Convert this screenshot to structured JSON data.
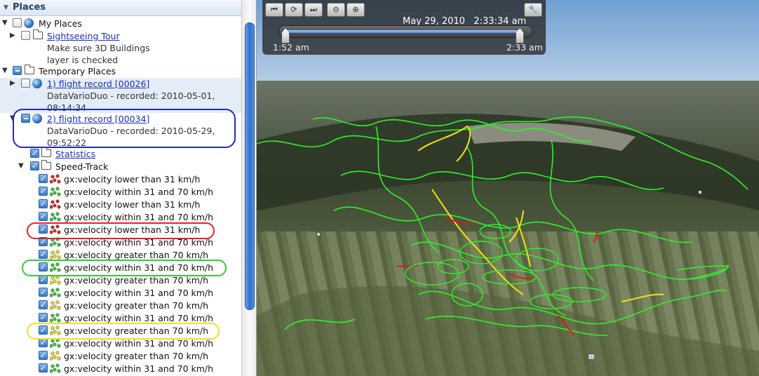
{
  "places": {
    "header": "Places",
    "my_places": {
      "label": "My Places",
      "sightseeing": {
        "label": "Sightseeing Tour",
        "note_line1": "Make sure 3D Buildings",
        "note_line2": "layer is checked"
      }
    },
    "temporary_places": {
      "label": "Temporary Places",
      "record1": {
        "label": "1) flight record [00026]",
        "desc_line1": "DataVarioDuo - recorded: 2010-05-01,",
        "desc_line2": "08:14:34"
      },
      "record2": {
        "label": "2) flight record [00034]",
        "desc_line1": "DataVarioDuo - recorded: 2010-05-29,",
        "desc_line2": "09:52:22"
      },
      "statistics": "Statistics",
      "speed_track": "Speed-Track",
      "segments": [
        {
          "label": "gx:velocity lower than 31 km/h",
          "color": "red"
        },
        {
          "label": "gx:velocity within  31 and 70 km/h",
          "color": "green"
        },
        {
          "label": "gx:velocity lower than 31 km/h",
          "color": "red"
        },
        {
          "label": "gx:velocity within  31 and 70 km/h",
          "color": "green"
        },
        {
          "label": "gx:velocity lower than 31 km/h",
          "color": "red"
        },
        {
          "label": "gx:velocity within  31 and 70 km/h",
          "color": "green"
        },
        {
          "label": "gx:velocity greater than 70 km/h",
          "color": "yellow"
        },
        {
          "label": "gx:velocity within  31 and 70 km/h",
          "color": "green"
        },
        {
          "label": "gx:velocity greater than 70 km/h",
          "color": "yellow"
        },
        {
          "label": "gx:velocity within  31 and 70 km/h",
          "color": "green"
        },
        {
          "label": "gx:velocity greater than 70 km/h",
          "color": "yellow"
        },
        {
          "label": "gx:velocity within  31 and 70 km/h",
          "color": "green"
        },
        {
          "label": "gx:velocity greater than 70 km/h",
          "color": "yellow"
        },
        {
          "label": "gx:velocity within  31 and 70 km/h",
          "color": "green"
        },
        {
          "label": "gx:velocity greater than 70 km/h",
          "color": "yellow"
        },
        {
          "label": "gx:velocity within  31 and 70 km/h",
          "color": "green"
        }
      ]
    }
  },
  "time_slider": {
    "current": "May 29, 2010   2:33:34 am",
    "start": "1:52 am",
    "end": "2:33 am"
  },
  "colors": {
    "red": "#e02020",
    "green": "#36c236",
    "yellow": "#e6d41a",
    "track_green": "#2ef02e",
    "track_yellow": "#f2e313",
    "track_red": "#e01818",
    "ring_blue": "#1f2fb8",
    "ring_red": "#e8202a",
    "ring_green": "#2fd02f",
    "ring_yellow": "#f2e020"
  }
}
